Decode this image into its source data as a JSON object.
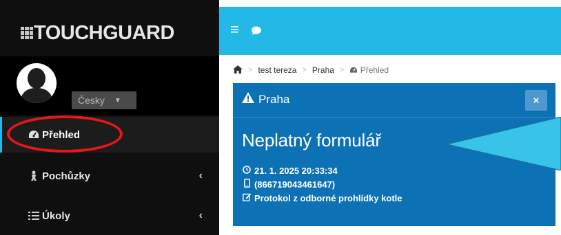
{
  "app": {
    "logo_text": "TOUCHGUARD"
  },
  "user": {
    "language": "Česky"
  },
  "sidebar": {
    "items": [
      {
        "label": "Přehled",
        "icon": "dashboard-icon",
        "active": true
      },
      {
        "label": "Pochůzky",
        "icon": "patrol-icon",
        "has_submenu": true
      },
      {
        "label": "Úkoly",
        "icon": "tasks-icon",
        "has_submenu": true
      }
    ]
  },
  "topbar": {
    "icons": [
      "hamburger-menu-icon",
      "chat-bubble-icon"
    ]
  },
  "breadcrumb": {
    "items": [
      "test tereza",
      "Praha",
      "Přehled"
    ],
    "separator": ">"
  },
  "alert": {
    "title": "Praha",
    "heading": "Neplatný formulář",
    "datetime": "21. 1. 2025 20:33:34",
    "device": "(866719043461647)",
    "form": "Protokol z odborné prohlídky kotle",
    "close_label": "×"
  },
  "colors": {
    "sidebar_bg": "#0f0f0f",
    "topbar_bg": "#23b9e6",
    "alert_bg": "#0d71b5",
    "annotation_red": "#e5171b",
    "callout_fill": "#38c3e8"
  }
}
